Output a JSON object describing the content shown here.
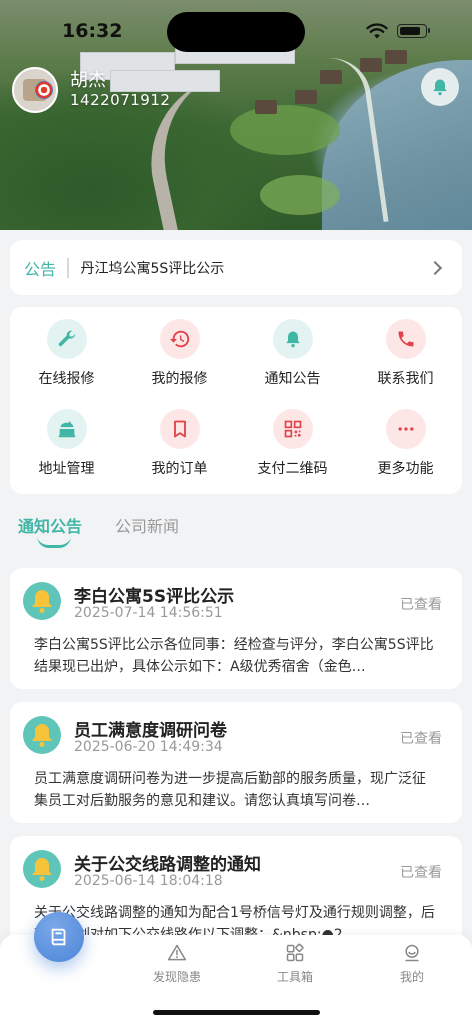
{
  "status_bar": {
    "time": "16:32",
    "battery_level": 0.85
  },
  "user": {
    "name": "胡杰",
    "id": "1422071912"
  },
  "notice": {
    "tag": "公告",
    "text": "丹江坞公寓5S评比公示"
  },
  "grid": [
    {
      "label": "在线报修",
      "icon": "wrench-icon",
      "tint": "teal"
    },
    {
      "label": "我的报修",
      "icon": "history-icon",
      "tint": "red"
    },
    {
      "label": "通知公告",
      "icon": "bell-icon",
      "tint": "teal"
    },
    {
      "label": "联系我们",
      "icon": "phone-icon",
      "tint": "red"
    },
    {
      "label": "地址管理",
      "icon": "address-icon",
      "tint": "teal"
    },
    {
      "label": "我的订单",
      "icon": "bookmark-icon",
      "tint": "red"
    },
    {
      "label": "支付二维码",
      "icon": "qrcode-icon",
      "tint": "red"
    },
    {
      "label": "更多功能",
      "icon": "more-icon",
      "tint": "red"
    }
  ],
  "tabs": {
    "active": "通知公告",
    "inactive": "公司新闻"
  },
  "feed": [
    {
      "title": "李白公寓5S评比公示",
      "time": "2025-07-14 14:56:51",
      "status": "已查看",
      "body": "李白公寓5S评比公示各位同事：经检查与评分，李白公寓5S评比结果现已出炉，具体公示如下：A级优秀宿舍（金色…"
    },
    {
      "title": "员工满意度调研问卷",
      "time": "2025-06-20 14:49:34",
      "status": "已查看",
      "body": "员工满意度调研问卷为进一步提高后勤部的服务质量，现广泛征集员工对后勤服务的意见和建议。请您认真填写问卷…"
    },
    {
      "title": "关于公交线路调整的通知",
      "time": "2025-06-14 18:04:18",
      "status": "已查看",
      "body": "关于公交线路调整的通知为配合1号桥信号灯及通行规则调整，后勤部计划对如下公交线路作以下调整：&nbsp;●2…"
    }
  ],
  "bottom_nav": [
    {
      "label": "发现隐患",
      "icon": "warning-icon"
    },
    {
      "label": "工具箱",
      "icon": "toolbox-icon"
    },
    {
      "label": "我的",
      "icon": "profile-icon"
    }
  ],
  "colors": {
    "accent": "#3fb6a6",
    "red_icon": "#e0424a",
    "teal_icon": "#3fb6a6"
  }
}
